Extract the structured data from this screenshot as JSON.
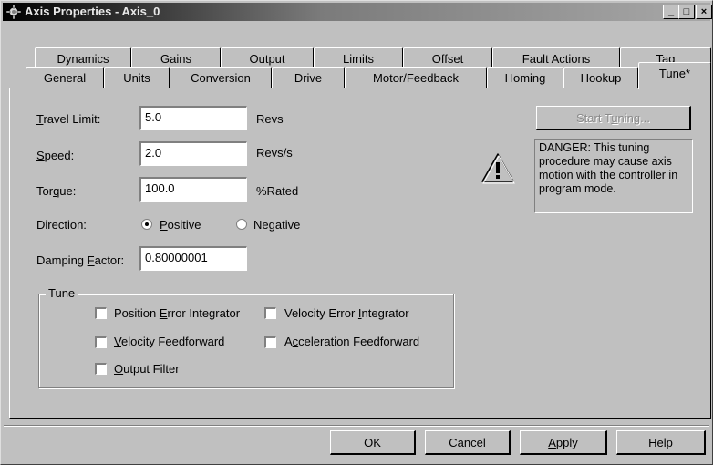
{
  "window": {
    "title": "Axis Properties - Axis_0",
    "controls": {
      "minimize": "_",
      "maximize": "□",
      "close": "×"
    }
  },
  "tabs": {
    "row_back": [
      "Dynamics",
      "Gains",
      "Output",
      "Limits",
      "Offset",
      "Fault Actions",
      "Tag"
    ],
    "row_front": [
      "General",
      "Units",
      "Conversion",
      "Drive",
      "Motor/Feedback",
      "Homing",
      "Hookup"
    ],
    "active": "Tune*"
  },
  "form": {
    "travel_limit": {
      "label_mnemonic": "T",
      "label_rest": "ravel Limit:",
      "value": "5.0",
      "unit": "Revs"
    },
    "speed": {
      "label_mnemonic": "S",
      "label_rest": "peed:",
      "value": "2.0",
      "unit": "Revs/s"
    },
    "torque": {
      "label_pre": "Tor",
      "label_mnemonic": "q",
      "label_rest": "ue:",
      "value": "100.0",
      "unit": "%Rated"
    },
    "direction": {
      "label": "Direction:",
      "positive_mnemonic": "P",
      "positive_rest": "ositive",
      "negative_pre": "Ne",
      "negative_mnemonic": "g",
      "negative_rest": "ative",
      "selected": "Positive"
    },
    "damping": {
      "label_pre": "Damping ",
      "label_mnemonic": "F",
      "label_rest": "actor:",
      "value": "0.80000001"
    }
  },
  "tune_group": {
    "title": "Tune",
    "options": {
      "position_error_integrator": {
        "pre": "Position ",
        "mnemonic": "E",
        "rest": "rror Integrator",
        "checked": false
      },
      "velocity_error_integrator": {
        "pre": "Velocity Error ",
        "mnemonic": "I",
        "rest": "ntegrator",
        "checked": false
      },
      "velocity_feedforward": {
        "pre": "",
        "mnemonic": "V",
        "rest": "elocity Feedforward",
        "checked": false
      },
      "acceleration_feedforward": {
        "pre": "A",
        "mnemonic": "c",
        "rest": "celeration Feedforward",
        "checked": false
      },
      "output_filter": {
        "pre": "",
        "mnemonic": "O",
        "rest": "utput Filter",
        "checked": false
      }
    }
  },
  "start_tuning": {
    "pre": "Start T",
    "mnemonic": "u",
    "rest": "ning..."
  },
  "warning": {
    "icon": "warning-icon",
    "text": "DANGER: This tuning procedure may cause axis motion with the controller in program mode."
  },
  "buttons": {
    "ok": "OK",
    "cancel": "Cancel",
    "apply_mnemonic": "A",
    "apply_rest": "pply",
    "help": "Help"
  }
}
